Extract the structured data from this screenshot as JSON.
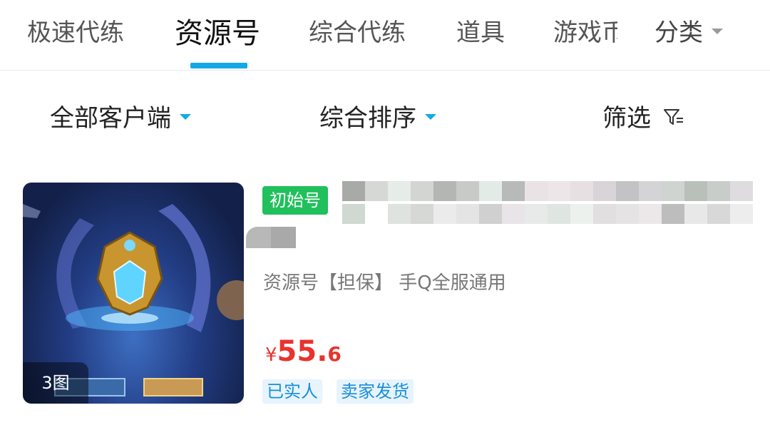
{
  "tabs": {
    "items": [
      "极速代练",
      "资源号",
      "综合代练",
      "道具"
    ],
    "clipped": "游戏币",
    "category": "分类"
  },
  "filters": {
    "client": "全部客户端",
    "sort": "综合排序",
    "screen": "筛选"
  },
  "listing": {
    "image_count": "3图",
    "tag": "初始号",
    "description": "资源号【担保】 手Q全服通用",
    "price_currency": "¥",
    "price_int": "55.",
    "price_dec": "6",
    "badges": [
      "已实人",
      "卖家发货"
    ]
  },
  "colors": {
    "accent": "#13a9e8",
    "price": "#e8332e",
    "tag": "#20c05c"
  }
}
